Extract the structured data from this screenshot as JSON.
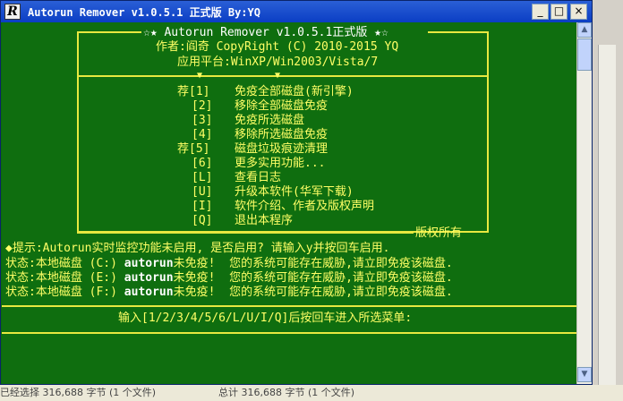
{
  "window": {
    "title": "Autorun Remover v1.0.5.1 正式版 By:YQ",
    "icon_letter": "R",
    "buttons": [
      "_",
      "□",
      "×"
    ]
  },
  "header": {
    "line1": "☆★ Autorun Remover v1.0.5.1正式版 ★☆",
    "line2": "作者:阎奇 CopyRight (C) 2010-2015 YQ",
    "line3": "应用平台:WinXP/Win2003/Vista/7"
  },
  "menu": [
    {
      "key": "荐[1]",
      "label": "免疫全部磁盘(新引擎)"
    },
    {
      "key": "[2]",
      "label": "移除全部磁盘免疫"
    },
    {
      "key": "[3]",
      "label": "免疫所选磁盘"
    },
    {
      "key": "[4]",
      "label": "移除所选磁盘免疫"
    },
    {
      "key": "荐[5]",
      "label": "磁盘垃圾痕迹清理"
    },
    {
      "key": "[6]",
      "label": "更多实用功能..."
    },
    {
      "key": "[L]",
      "label": "查看日志"
    },
    {
      "key": "[U]",
      "label": "升级本软件(华军下载)"
    },
    {
      "key": "[I]",
      "label": "软件介绍、作者及版权声明"
    },
    {
      "key": "[Q]",
      "label": "退出本程序"
    }
  ],
  "copyright_tag": "版权所有",
  "tip": "◆提示:Autorun实时监控功能未启用, 是否启用? 请输入y并按回车启用.",
  "statuses": [
    {
      "prefix": "状态:本地磁盘 (C:) ",
      "name": "autorun",
      "suffix": "未免疫!  您的系统可能存在威胁,请立即免疫该磁盘."
    },
    {
      "prefix": "状态:本地磁盘 (E:) ",
      "name": "autorun",
      "suffix": "未免疫!  您的系统可能存在威胁,请立即免疫该磁盘."
    },
    {
      "prefix": "状态:本地磁盘 (F:) ",
      "name": "autorun",
      "suffix": "未免疫!  您的系统可能存在威胁,请立即免疫该磁盘."
    }
  ],
  "prompt": "输入[1/2/3/4/5/6/L/U/I/Q]后按回车进入所选菜单:",
  "bottom_text": "已经选择 316,688 字节 (1 个文件)                    总计 316,688 字节 (1 个文件)"
}
